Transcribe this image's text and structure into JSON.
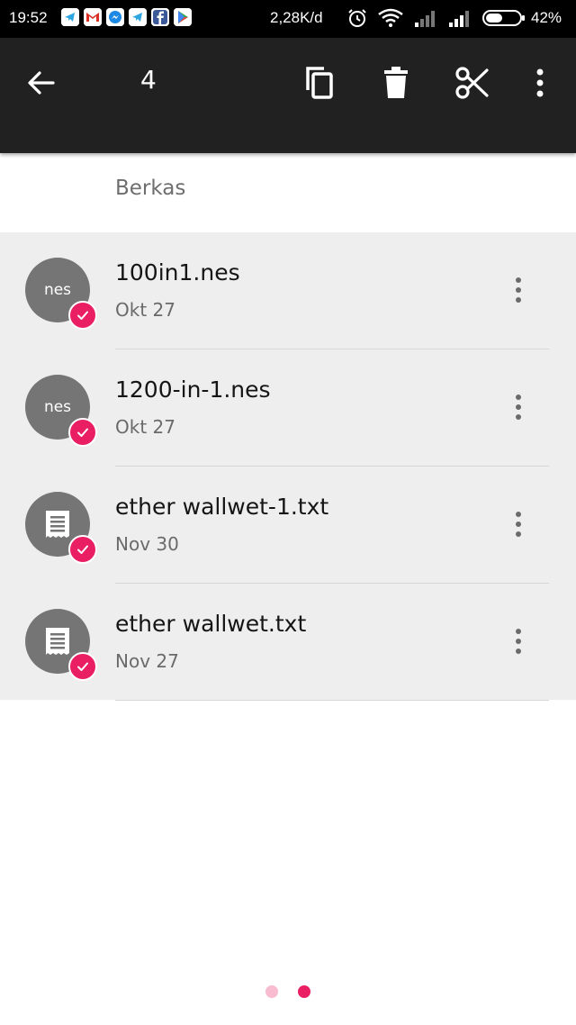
{
  "status_bar": {
    "time": "19:52",
    "network_speed": "2,28K/d",
    "battery_percent": "42%",
    "notification_icons": [
      "telegram-icon",
      "gmail-icon",
      "messenger-icon",
      "telegram-icon",
      "facebook-icon",
      "play-store-icon"
    ],
    "status_icons": [
      "alarm-icon",
      "wifi-icon",
      "signal-icon",
      "signal-icon",
      "battery-icon"
    ]
  },
  "toolbar": {
    "selected_count": "4",
    "actions": [
      "back-arrow-icon",
      "copy-icon",
      "delete-icon",
      "cut-icon",
      "more-vert-icon"
    ]
  },
  "section": {
    "title": "Berkas"
  },
  "files": [
    {
      "name": "100in1.nes",
      "date": "Okt 27",
      "avatar_label": "nes",
      "type": "nes",
      "selected": true
    },
    {
      "name": "1200-in-1.nes",
      "date": "Okt 27",
      "avatar_label": "nes",
      "type": "nes",
      "selected": true
    },
    {
      "name": "ether wallwet-1.txt",
      "date": "Nov 30",
      "avatar_label": "",
      "type": "txt",
      "selected": true
    },
    {
      "name": "ether wallwet.txt",
      "date": "Nov 27",
      "avatar_label": "",
      "type": "txt",
      "selected": true
    }
  ],
  "page_indicator": {
    "count": 2,
    "active_index": 1
  },
  "colors": {
    "toolbar": "#212121",
    "row_selected": "#eeeeee",
    "avatar": "#757575",
    "accent": "#e91e63",
    "dot_inactive": "#f8bbd0"
  }
}
